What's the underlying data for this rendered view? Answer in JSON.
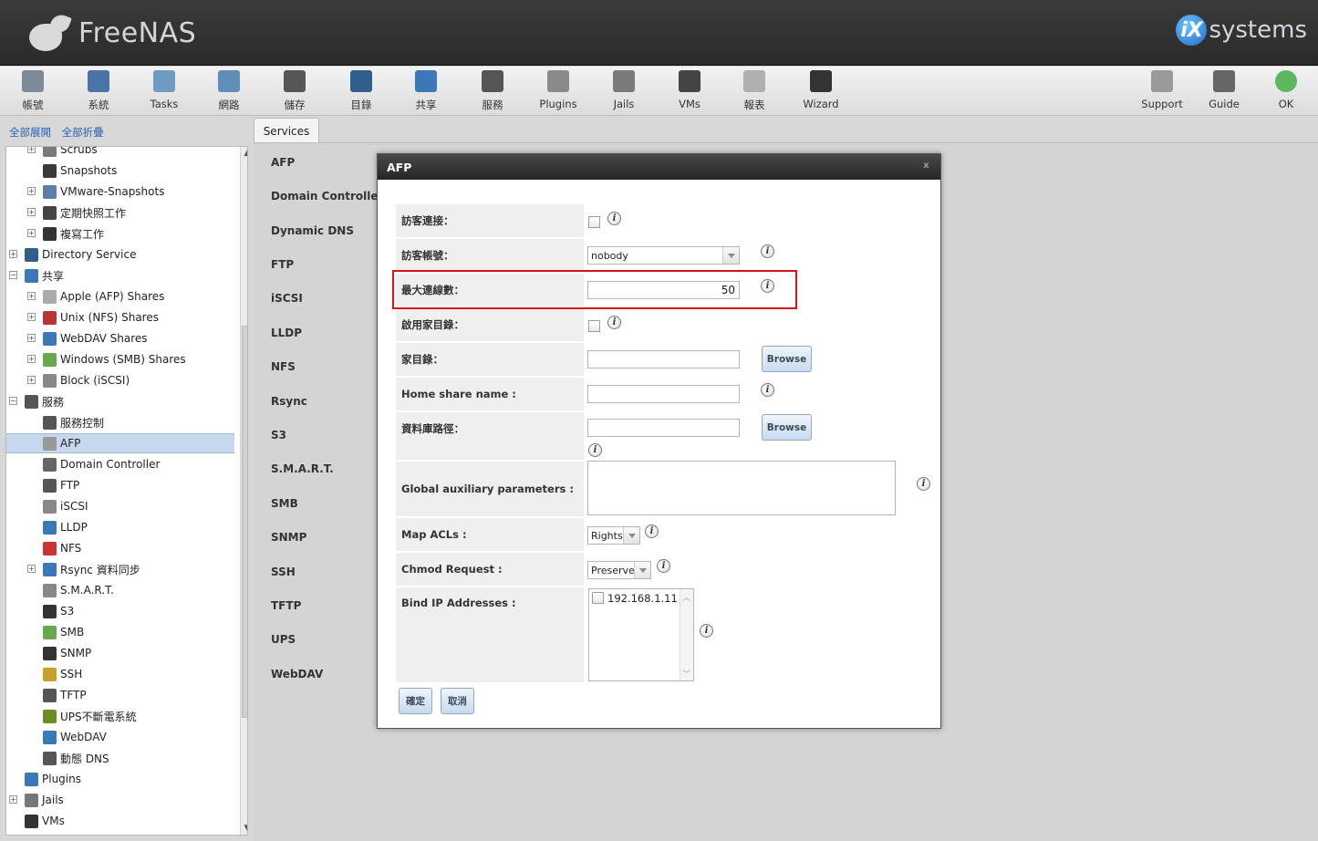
{
  "header": {
    "logo_text": "FreeNAS",
    "vendor_badge": "iX",
    "vendor_text": "systems"
  },
  "toolbar": {
    "items": [
      {
        "label": "帳號",
        "icon": "users-icon",
        "color": "#7c8a99"
      },
      {
        "label": "系統",
        "icon": "system-icon",
        "color": "#4a74a8"
      },
      {
        "label": "Tasks",
        "icon": "tasks-icon",
        "color": "#6f9ac4"
      },
      {
        "label": "網路",
        "icon": "network-icon",
        "color": "#5f8fb8"
      },
      {
        "label": "儲存",
        "icon": "storage-icon",
        "color": "#555555"
      },
      {
        "label": "目錄",
        "icon": "directory-icon",
        "color": "#2f5f8a"
      },
      {
        "label": "共享",
        "icon": "sharing-icon",
        "color": "#3a78b8"
      },
      {
        "label": "服務",
        "icon": "services-icon",
        "color": "#555555"
      },
      {
        "label": "Plugins",
        "icon": "plugins-icon",
        "color": "#8a8a8a"
      },
      {
        "label": "Jails",
        "icon": "jails-icon",
        "color": "#7a7a7a"
      },
      {
        "label": "VMs",
        "icon": "vms-icon",
        "color": "#444444"
      },
      {
        "label": "報表",
        "icon": "reports-icon",
        "color": "#b0b0b0"
      },
      {
        "label": "Wizard",
        "icon": "wizard-icon",
        "color": "#333333"
      }
    ],
    "right_items": [
      {
        "label": "Support",
        "icon": "support-icon",
        "color": "#9a9a9a"
      },
      {
        "label": "Guide",
        "icon": "guide-icon",
        "color": "#666666"
      },
      {
        "label": "OK",
        "icon": "status-ok-icon",
        "color": "#5cb85c"
      }
    ]
  },
  "sidebar": {
    "expand_all": "全部展開",
    "collapse_all": "全部折疊",
    "tree": [
      {
        "label": "Scrubs",
        "level": 2,
        "exp": true
      },
      {
        "label": "Snapshots",
        "level": 2,
        "exp": false
      },
      {
        "label": "VMware-Snapshots",
        "level": 2,
        "exp": true
      },
      {
        "label": "定期快照工作",
        "level": 2,
        "exp": true
      },
      {
        "label": "複寫工作",
        "level": 2,
        "exp": true
      },
      {
        "label": "Directory Service",
        "level": 1,
        "exp": true
      },
      {
        "label": "共享",
        "level": 1,
        "exp": "open"
      },
      {
        "label": "Apple (AFP) Shares",
        "level": 2,
        "exp": true
      },
      {
        "label": "Unix (NFS) Shares",
        "level": 2,
        "exp": true
      },
      {
        "label": "WebDAV Shares",
        "level": 2,
        "exp": true
      },
      {
        "label": "Windows (SMB) Shares",
        "level": 2,
        "exp": true
      },
      {
        "label": "Block (iSCSI)",
        "level": 2,
        "exp": true
      },
      {
        "label": "服務",
        "level": 1,
        "exp": "open"
      },
      {
        "label": "服務控制",
        "level": 2,
        "exp": false
      },
      {
        "label": "AFP",
        "level": 2,
        "exp": false,
        "selected": true
      },
      {
        "label": "Domain Controller",
        "level": 2,
        "exp": false
      },
      {
        "label": "FTP",
        "level": 2,
        "exp": false
      },
      {
        "label": "iSCSI",
        "level": 2,
        "exp": false
      },
      {
        "label": "LLDP",
        "level": 2,
        "exp": false
      },
      {
        "label": "NFS",
        "level": 2,
        "exp": false
      },
      {
        "label": "Rsync 資料同步",
        "level": 2,
        "exp": true
      },
      {
        "label": "S.M.A.R.T.",
        "level": 2,
        "exp": false
      },
      {
        "label": "S3",
        "level": 2,
        "exp": false
      },
      {
        "label": "SMB",
        "level": 2,
        "exp": false
      },
      {
        "label": "SNMP",
        "level": 2,
        "exp": false
      },
      {
        "label": "SSH",
        "level": 2,
        "exp": false
      },
      {
        "label": "TFTP",
        "level": 2,
        "exp": false
      },
      {
        "label": "UPS不斷電系統",
        "level": 2,
        "exp": false
      },
      {
        "label": "WebDAV",
        "level": 2,
        "exp": false
      },
      {
        "label": "動態 DNS",
        "level": 2,
        "exp": false
      },
      {
        "label": "Plugins",
        "level": 1,
        "exp": false
      },
      {
        "label": "Jails",
        "level": 1,
        "exp": true
      },
      {
        "label": "VMs",
        "level": 1,
        "exp": false
      }
    ]
  },
  "tabs": {
    "services": "Services"
  },
  "services_list": [
    "AFP",
    "Domain Controller",
    "Dynamic DNS",
    "FTP",
    "iSCSI",
    "LLDP",
    "NFS",
    "Rsync",
    "S3",
    "S.M.A.R.T.",
    "SMB",
    "SNMP",
    "SSH",
    "TFTP",
    "UPS",
    "WebDAV"
  ],
  "dialog": {
    "title": "AFP",
    "close": "x",
    "fields": {
      "guest_access": "訪客連接：",
      "guest_account": "訪客帳號：",
      "guest_account_value": "nobody",
      "max_connections": "最大連線數：",
      "max_connections_value": "50",
      "home_dir_enable": "啟用家目錄：",
      "home_dir": "家目錄：",
      "home_share_name": "Home share name :",
      "db_path": "資料庫路徑：",
      "global_aux": "Global auxiliary parameters :",
      "map_acls": "Map ACLs :",
      "map_acls_value": "Rights",
      "chmod_request": "Chmod Request :",
      "chmod_request_value": "Preserve",
      "bind_ip": "Bind IP Addresses :",
      "bind_ip_option": "192.168.1.11"
    },
    "browse_label": "Browse",
    "info_glyph": "i",
    "ok_label": "確定",
    "cancel_label": "取消"
  },
  "colors": {
    "highlight": "#d9121c",
    "link": "#2a62b4",
    "selected_row": "#c7d8ee"
  }
}
